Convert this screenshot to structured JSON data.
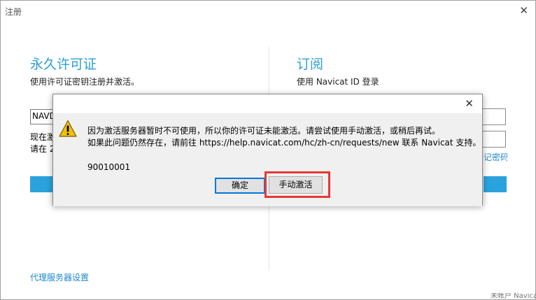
{
  "window": {
    "title": "注册",
    "close_glyph": "✕"
  },
  "permanent": {
    "title": "永久许可证",
    "description": "使用许可证密钥注册并激活。",
    "key_value": "NAVD",
    "now_text": "现在激",
    "please_text": "请在 2",
    "proxy_link": "代理服务器设置"
  },
  "subscription": {
    "title": "订阅",
    "description": "使用 Navicat ID 登录",
    "forgot_link": "记密码",
    "footer_note": "未帐户  Navicat 帐户"
  },
  "dialog": {
    "close_glyph": "✕",
    "icon": "warning-icon",
    "message_line1": "因为激活服务器暂时不可使用，所以你的许可证未能激活。请尝试使用手动激活，或稍后再试。",
    "message_line2": "如果此问题仍然存在，请前往 https://help.navicat.com/hc/zh-cn/requests/new 联系 Navicat 支持。",
    "error_code": "90010001",
    "ok_label": "确定",
    "manual_label": "手动激活"
  },
  "colors": {
    "accent": "#2aa3dd",
    "link": "#1e88d0",
    "highlight": "#e53935",
    "warning": "#f2c200"
  }
}
